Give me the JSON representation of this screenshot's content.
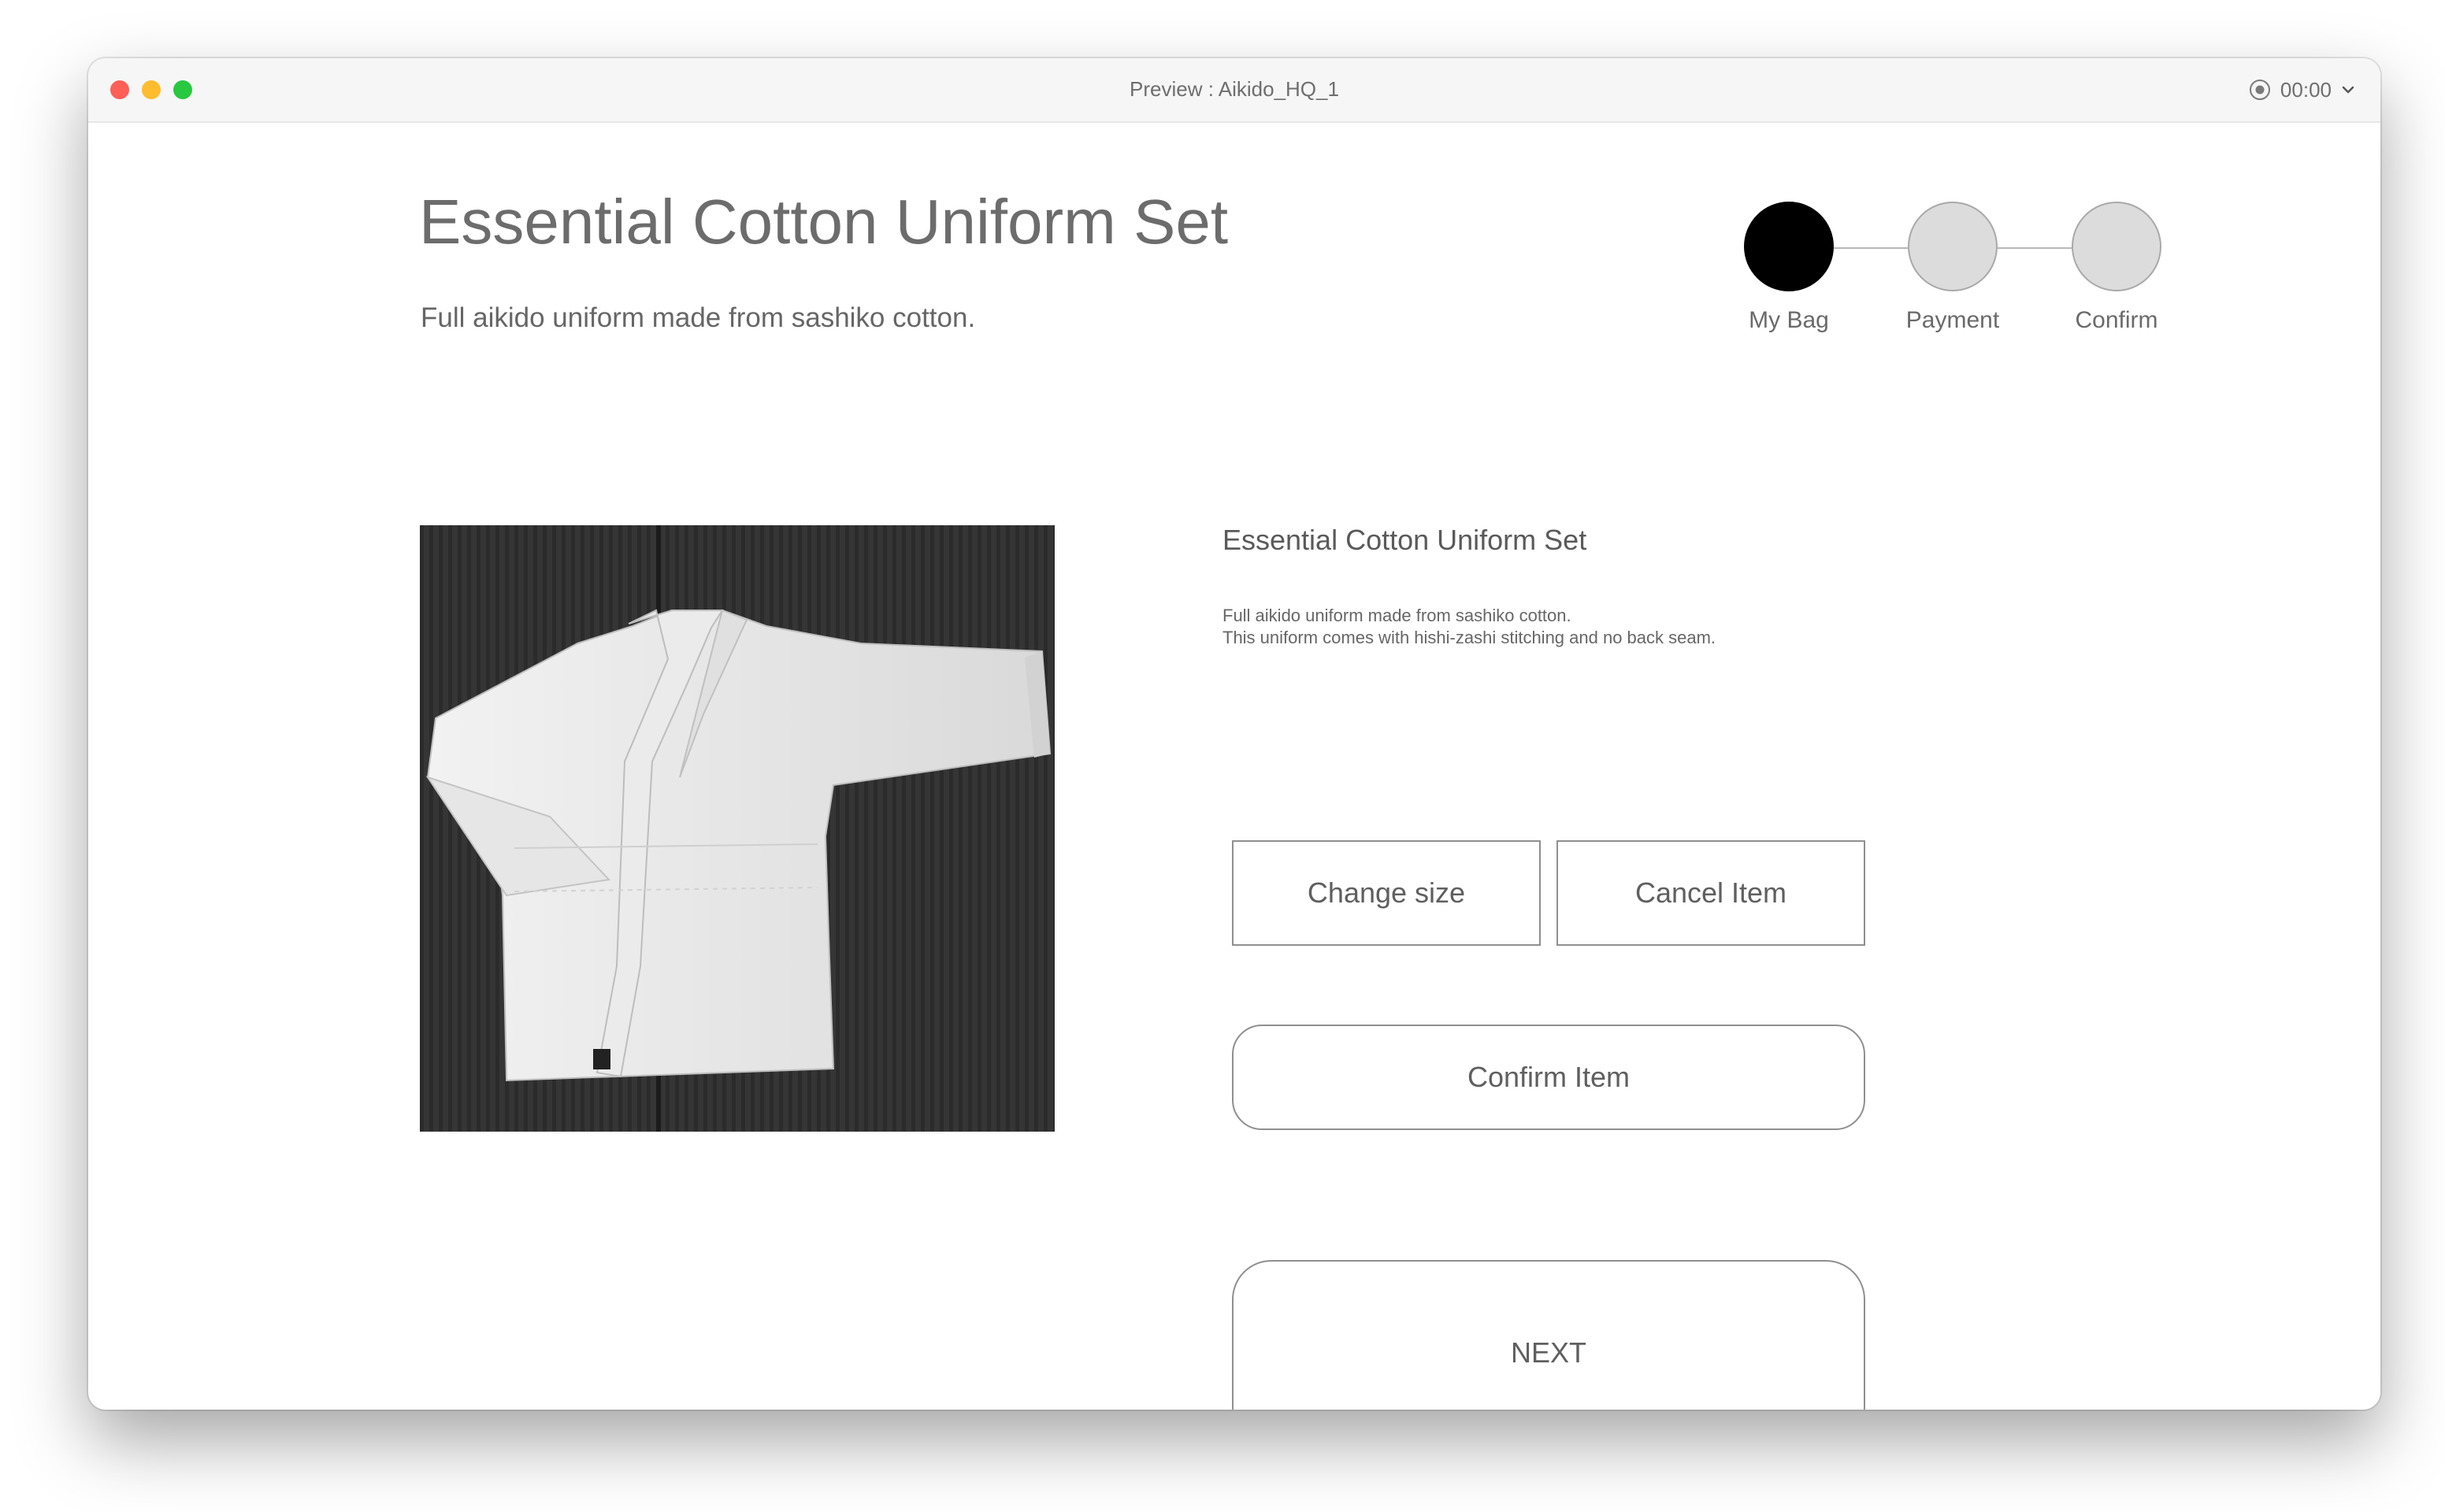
{
  "window": {
    "title": "Preview : Aikido_HQ_1",
    "timer": "00:00"
  },
  "header": {
    "title": "Essential Cotton Uniform Set",
    "subtitle": "Full aikido uniform made from sashiko cotton."
  },
  "stepper": {
    "steps": [
      {
        "label": "My Bag",
        "active": true
      },
      {
        "label": "Payment",
        "active": false
      },
      {
        "label": "Confirm",
        "active": false
      }
    ]
  },
  "product": {
    "name": "Essential Cotton Uniform Set",
    "description_lines": [
      "Full aikido uniform made from sashiko cotton.",
      "This uniform comes with hishi-zashi stitching and no back seam."
    ]
  },
  "actions": {
    "change_size": "Change size",
    "cancel_item": "Cancel Item",
    "confirm_item": "Confirm Item",
    "next": "NEXT"
  },
  "colors": {
    "active_step": "#000000",
    "inactive_step": "#dcdcdc",
    "button_border": "#8f8f8f"
  }
}
